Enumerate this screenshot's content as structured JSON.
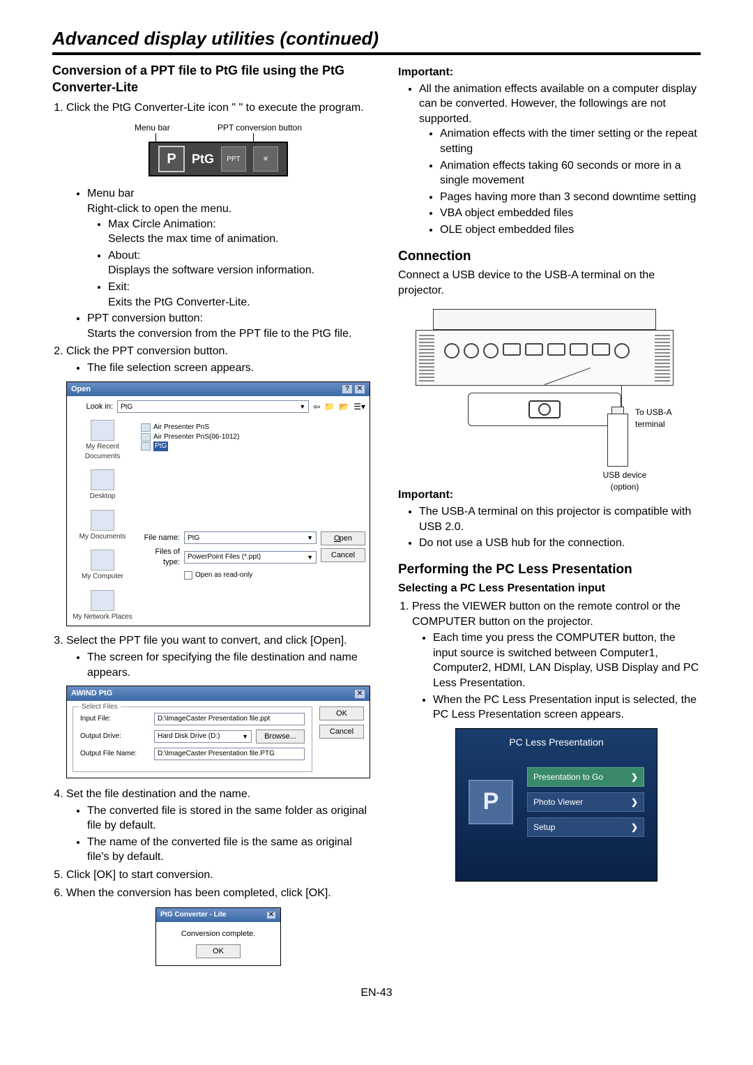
{
  "page": {
    "title": "Advanced display utilities (continued)",
    "number": "EN-43"
  },
  "left": {
    "heading": "Conversion of a PPT file to PtG file using the PtG Converter-Lite",
    "step1": "Click the PtG Converter-Lite icon \"    \" to execute the program.",
    "fig_labels": {
      "menu": "Menu bar",
      "ppt_btn": "PPT conversion button",
      "ptg_text": "PtG",
      "ppt_badge": "PPT"
    },
    "menu_bar": {
      "title": "Menu bar",
      "desc": "Right-click to open the menu.",
      "items": [
        {
          "name": "Max Circle Animation:",
          "desc": "Selects the max time of animation."
        },
        {
          "name": "About:",
          "desc": "Displays the software version information."
        },
        {
          "name": "Exit:",
          "desc": "Exits the PtG Converter-Lite."
        }
      ]
    },
    "ppt_btn": {
      "title": "PPT conversion button:",
      "desc": "Starts the conversion from the PPT file to the PtG file."
    },
    "step2": "Click the PPT conversion button.",
    "step2_sub": "The file selection screen appears.",
    "open_dlg": {
      "title": "Open",
      "lookin_label": "Look in:",
      "lookin_value": "PtG",
      "side": [
        "My Recent Documents",
        "Desktop",
        "My Documents",
        "My Computer",
        "My Network Places"
      ],
      "files": [
        "Air Presenter PnS",
        "Air Presenter PnS(06-1012)",
        "PtG"
      ],
      "filename_label": "File name:",
      "filename_value": "PtG",
      "type_label": "Files of type:",
      "type_value": "PowerPoint Files (*.ppt)",
      "readonly": "Open as read-only",
      "open_btn": "Open",
      "cancel_btn": "Cancel"
    },
    "step3": "Select the PPT file you want to convert, and click [Open].",
    "step3_sub": "The screen for specifying the file destination and name appears.",
    "awind": {
      "title": "AWIND PtG",
      "legend": "Select Files",
      "input_label": "Input File:",
      "input_value": "D:\\ImageCaster Presentation file.ppt",
      "drive_label": "Output Drive:",
      "drive_value": "Hard Disk Drive (D:)",
      "browse": "Browse...",
      "outname_label": "Output File Name:",
      "outname_value": "D:\\ImageCaster Presentation file.PTG",
      "ok": "OK",
      "cancel": "Cancel"
    },
    "step4": "Set the file destination and the name.",
    "step4_subs": [
      "The converted file is stored in the same folder as original file by default.",
      "The name of the converted file is the same as original file's by default."
    ],
    "step5": "Click [OK] to start conversion.",
    "step6": "When the conversion has been completed, click [OK].",
    "done": {
      "title": "PtG Converter - Lite",
      "msg": "Conversion complete.",
      "ok": "OK"
    }
  },
  "right": {
    "important_label": "Important:",
    "imp1_intro": "All the animation effects available on a computer display can be converted. However, the followings are not supported.",
    "imp1_items": [
      "Animation effects with the timer setting or the repeat setting",
      "Animation effects taking 60 seconds or more  in a single movement",
      "Pages having more than 3 second downtime setting",
      "VBA object embedded files",
      "OLE object embedded files"
    ],
    "conn_heading": "Connection",
    "conn_text": "Connect a USB device to the USB-A terminal on the projector.",
    "proj_labels": {
      "usba": "To USB-A terminal",
      "dev": "USB device (option)"
    },
    "imp2_items": [
      "The USB-A terminal on this projector is compatible with USB 2.0.",
      "Do not use a USB hub for the connection."
    ],
    "pcless_heading": "Performing the PC Less Presentation",
    "pcless_sub": "Selecting a PC Less Presentation input",
    "pcless_step1": "Press the VIEWER button on the remote control or the COMPUTER button on the projector.",
    "pcless_subs": [
      "Each time you press the COMPUTER button, the input source is switched between Computer1, Computer2, HDMI, LAN Display, USB Display and PC Less Presentation.",
      "When the PC Less Presentation input is selected, the PC Less Presentation screen appears."
    ],
    "screen": {
      "title": "PC Less Presentation",
      "items": [
        "Presentation to Go",
        "Photo Viewer",
        "Setup"
      ]
    }
  }
}
